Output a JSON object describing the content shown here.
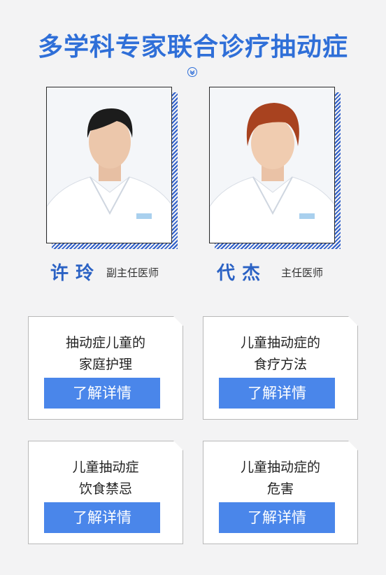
{
  "header": {
    "title": "多学科专家联合诊疗抽动症"
  },
  "doctors": [
    {
      "name": "许玲",
      "role": "副主任医师"
    },
    {
      "name": "代杰",
      "role": "主任医师"
    }
  ],
  "cards": [
    {
      "line1": "抽动症儿童的",
      "line2": "家庭护理",
      "button": "了解详情"
    },
    {
      "line1": "儿童抽动症的",
      "line2": "食疗方法",
      "button": "了解详情"
    },
    {
      "line1": "儿童抽动症",
      "line2": "饮食禁忌",
      "button": "了解详情"
    },
    {
      "line1": "儿童抽动症的",
      "line2": "危害",
      "button": "了解详情"
    }
  ],
  "colors": {
    "accent": "#2f6fd8",
    "button": "#4a86ea",
    "background": "#f3f3f4"
  }
}
